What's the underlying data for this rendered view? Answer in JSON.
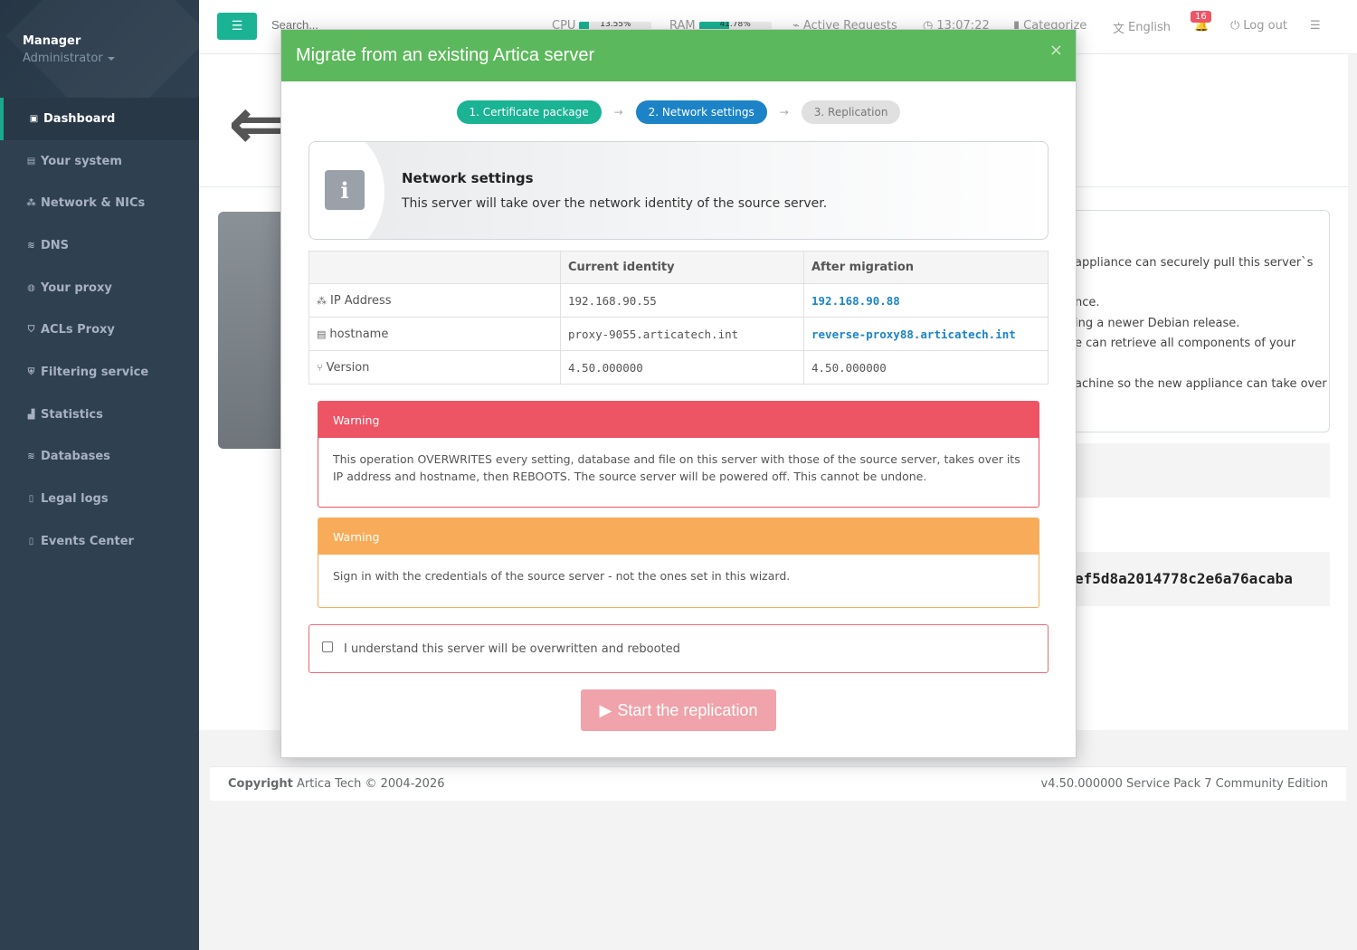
{
  "sidebar": {
    "user_name": "Manager",
    "user_role": "Administrator",
    "items": [
      {
        "label": "Dashboard",
        "icon": "dashboard-icon"
      },
      {
        "label": "Your system",
        "icon": "server-icon"
      },
      {
        "label": "Network & NICs",
        "icon": "network-icon"
      },
      {
        "label": "DNS",
        "icon": "database-icon"
      },
      {
        "label": "Your proxy",
        "icon": "globe-icon"
      },
      {
        "label": "ACLs Proxy",
        "icon": "shield-icon"
      },
      {
        "label": "Filtering service",
        "icon": "shield-check-icon"
      },
      {
        "label": "Statistics",
        "icon": "chart-icon"
      },
      {
        "label": "Databases",
        "icon": "database-icon"
      },
      {
        "label": "Legal logs",
        "icon": "file-lock-icon"
      },
      {
        "label": "Events Center",
        "icon": "file-icon"
      }
    ]
  },
  "topbar": {
    "search_placeholder": "Search...",
    "cpu_label": "CPU",
    "cpu_value": "13.55%",
    "cpu_fraction": 0.1355,
    "ram_label": "RAM",
    "ram_value": "41.78%",
    "ram_fraction": 0.4178,
    "active_requests": "Active Requests",
    "clock": "13:07:22",
    "categorize": "Categorize",
    "language": "English",
    "notifications_count": "16",
    "logout": "Log out"
  },
  "background": {
    "line1": "appliance can securely pull this server`s",
    "line2": "nce.",
    "line3": "ing a newer Debian release.",
    "line4": "e can retrieve all components of your",
    "line5": "achine so the new appliance can take over",
    "hash": "ef5d8a2014778c2e6a76acaba"
  },
  "footer": {
    "copyright_strong": "Copyright",
    "copyright_text": "Artica Tech © 2004-2026",
    "version": "v4.50.000000 Service Pack 7 Community Edition"
  },
  "modal": {
    "title": "Migrate from an existing Artica server",
    "close": "×",
    "steps": [
      {
        "label": "1. Certificate package",
        "state": "done"
      },
      {
        "label": "2. Network settings",
        "state": "current"
      },
      {
        "label": "3. Replication",
        "state": "todo"
      }
    ],
    "step_separator": "→",
    "info": {
      "title": "Network settings",
      "text": "This server will take over the network identity of the source server."
    },
    "table": {
      "headers": [
        "",
        "Current identity",
        "After migration"
      ],
      "rows": [
        {
          "label": "IP Address",
          "icon": "network-icon",
          "current": "192.168.90.55",
          "after": "192.168.90.88",
          "changed": true
        },
        {
          "label": "hostname",
          "icon": "server-icon",
          "current": "proxy-9055.articatech.int",
          "after": "reverse-proxy88.articatech.int",
          "changed": true
        },
        {
          "label": "Version",
          "icon": "branch-icon",
          "current": "4.50.000000",
          "after": "4.50.000000",
          "changed": false
        }
      ]
    },
    "warning_red": {
      "title": "Warning",
      "text": "This operation OVERWRITES every setting, database and file on this server with those of the source server, takes over its IP address and hostname, then REBOOTS. The source server will be powered off. This cannot be undone."
    },
    "warning_orange": {
      "title": "Warning",
      "text": "Sign in with the credentials of the source server - not the ones set in this wizard."
    },
    "confirm_label": "I understand this server will be overwritten and rebooted",
    "start_button": "Start the replication"
  },
  "colors": {
    "sidebar_bg": "#2f4050",
    "accent": "#1ab394",
    "modal_header": "#5cb85c",
    "step_current": "#1c84c6",
    "danger": "#ed5565",
    "warning": "#f8ac59"
  }
}
